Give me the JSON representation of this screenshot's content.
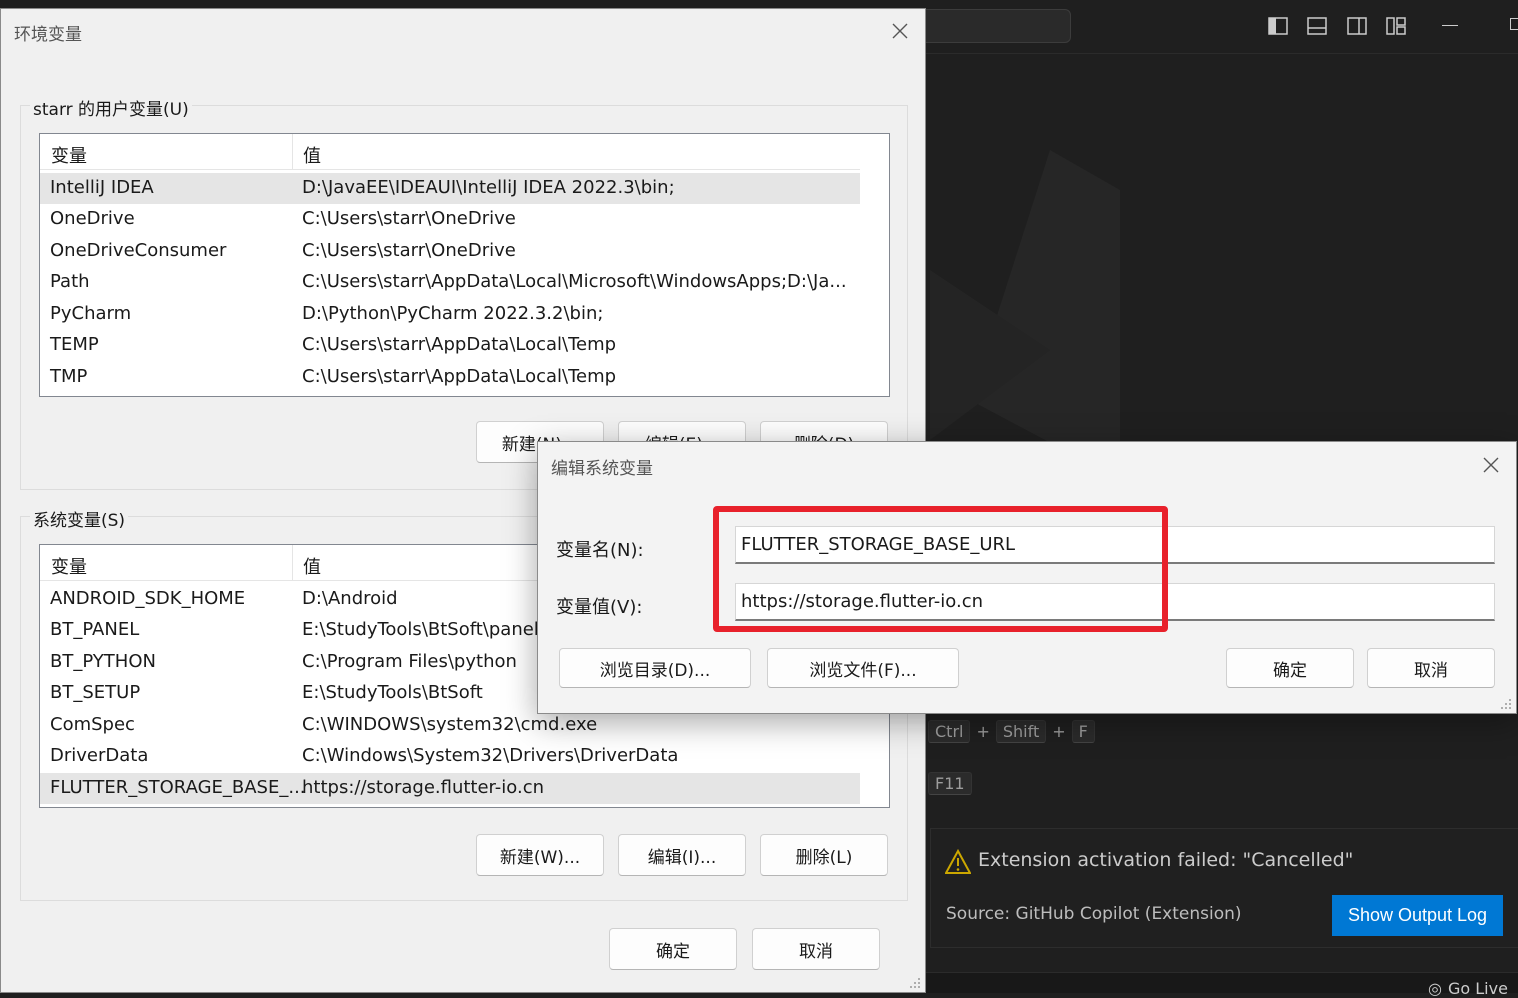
{
  "env_dialog": {
    "title": "环境变量",
    "user_group_label": "starr 的用户变量(U)",
    "system_group_label": "系统变量(S)",
    "col_var": "变量",
    "col_val": "值",
    "user_vars": [
      {
        "name": "IntelliJ IDEA",
        "value": "D:\\JavaEE\\IDEAUI\\IntelliJ IDEA 2022.3\\bin;"
      },
      {
        "name": "OneDrive",
        "value": "C:\\Users\\starr\\OneDrive"
      },
      {
        "name": "OneDriveConsumer",
        "value": "C:\\Users\\starr\\OneDrive"
      },
      {
        "name": "Path",
        "value": "C:\\Users\\starr\\AppData\\Local\\Microsoft\\WindowsApps;D:\\Ja..."
      },
      {
        "name": "PyCharm",
        "value": "D:\\Python\\PyCharm 2022.3.2\\bin;"
      },
      {
        "name": "TEMP",
        "value": "C:\\Users\\starr\\AppData\\Local\\Temp"
      },
      {
        "name": "TMP",
        "value": "C:\\Users\\starr\\AppData\\Local\\Temp"
      }
    ],
    "system_vars": [
      {
        "name": "ANDROID_SDK_HOME",
        "value": "D:\\Android"
      },
      {
        "name": "BT_PANEL",
        "value": "E:\\StudyTools\\BtSoft\\panel"
      },
      {
        "name": "BT_PYTHON",
        "value": "C:\\Program Files\\python"
      },
      {
        "name": "BT_SETUP",
        "value": "E:\\StudyTools\\BtSoft"
      },
      {
        "name": "ComSpec",
        "value": "C:\\WINDOWS\\system32\\cmd.exe"
      },
      {
        "name": "DriverData",
        "value": "C:\\Windows\\System32\\Drivers\\DriverData"
      },
      {
        "name": "FLUTTER_STORAGE_BASE_...",
        "value": "https://storage.flutter-io.cn"
      }
    ],
    "user_buttons": {
      "new": "新建(N)...",
      "edit": "编辑(E)...",
      "delete": "删除(D)"
    },
    "system_buttons": {
      "new": "新建(W)...",
      "edit": "编辑(I)...",
      "delete": "删除(L)"
    },
    "ok": "确定",
    "cancel": "取消"
  },
  "edit_dialog": {
    "title": "编辑系统变量",
    "name_label": "变量名(N):",
    "name_value": "FLUTTER_STORAGE_BASE_URL",
    "value_label": "变量值(V):",
    "value_value": "https://storage.flutter-io.cn",
    "browse_dir": "浏览目录(D)...",
    "browse_file": "浏览文件(F)...",
    "ok": "确定",
    "cancel": "取消"
  },
  "vscode": {
    "shortcuts": [
      {
        "keys": [
          "Ctrl",
          "Shift",
          "F"
        ]
      },
      {
        "keys": [
          "F11"
        ]
      }
    ],
    "notification": {
      "message": "Extension activation failed: \"Cancelled\"",
      "source": "Source: GitHub Copilot (Extension)",
      "button": "Show Output Log"
    },
    "status_golive": "Go Live",
    "colors": {
      "accent": "#0078d4",
      "warning": "#cca700",
      "highlight": "#e8212b"
    }
  }
}
